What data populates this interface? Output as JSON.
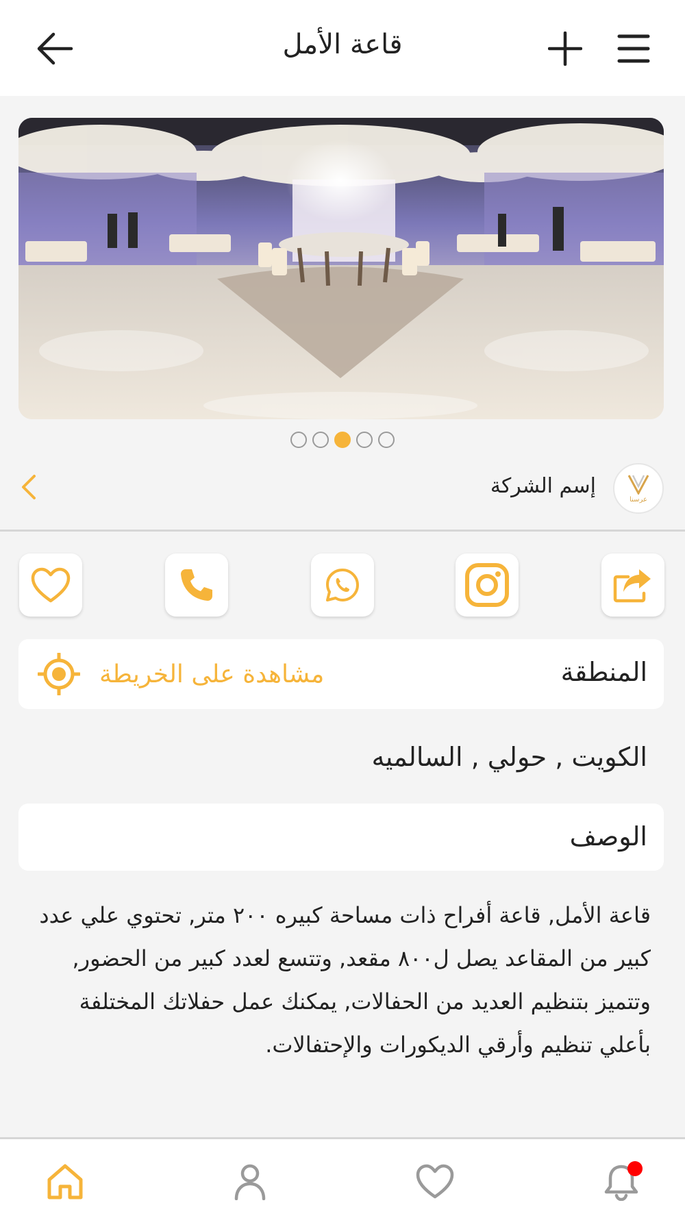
{
  "header": {
    "title": "قاعة الأمل",
    "back_icon": "arrow-left-icon",
    "add_icon": "plus-icon",
    "menu_icon": "hamburger-menu-icon"
  },
  "gallery": {
    "image_alt": "wedding hall photo",
    "slide_count": 5,
    "active_index": 2
  },
  "company": {
    "name": "إسم الشركة",
    "logo_text": "عرسنا",
    "arrow_icon": "chevron-left-icon"
  },
  "actions": [
    {
      "name": "favorite",
      "icon": "heart-icon"
    },
    {
      "name": "call",
      "icon": "phone-icon"
    },
    {
      "name": "whatsapp",
      "icon": "whatsapp-icon"
    },
    {
      "name": "instagram",
      "icon": "instagram-icon"
    },
    {
      "name": "share",
      "icon": "share-icon"
    }
  ],
  "region": {
    "label": "المنطقة",
    "map_link": "مشاهدة على الخريطة",
    "map_icon": "location-target-icon",
    "location": "الكويت , حولي , السالميه"
  },
  "description": {
    "label": "الوصف",
    "text": "قاعة الأمل, قاعة أفراح ذات مساحة كبيره ٢٠٠ متر, تحتوي علي عدد كبير من المقاعد يصل ل٨٠٠ مقعد, وتتسع لعدد كبير من الحضور, وتتميز بتنظيم العديد من الحفالات, يمكنك عمل حفلاتك المختلفة بأعلي تنظيم وأرقي الديكورات والإحتفالات."
  },
  "bottom_nav": [
    {
      "name": "home",
      "icon": "home-icon",
      "active": true
    },
    {
      "name": "profile",
      "icon": "user-icon",
      "active": false
    },
    {
      "name": "favorites",
      "icon": "heart-icon",
      "active": false
    },
    {
      "name": "notifications",
      "icon": "bell-icon",
      "active": false,
      "badge": true
    }
  ],
  "colors": {
    "accent": "#f6b43a",
    "badge": "#ff0000",
    "text": "#222222",
    "background": "#f4f4f4"
  }
}
